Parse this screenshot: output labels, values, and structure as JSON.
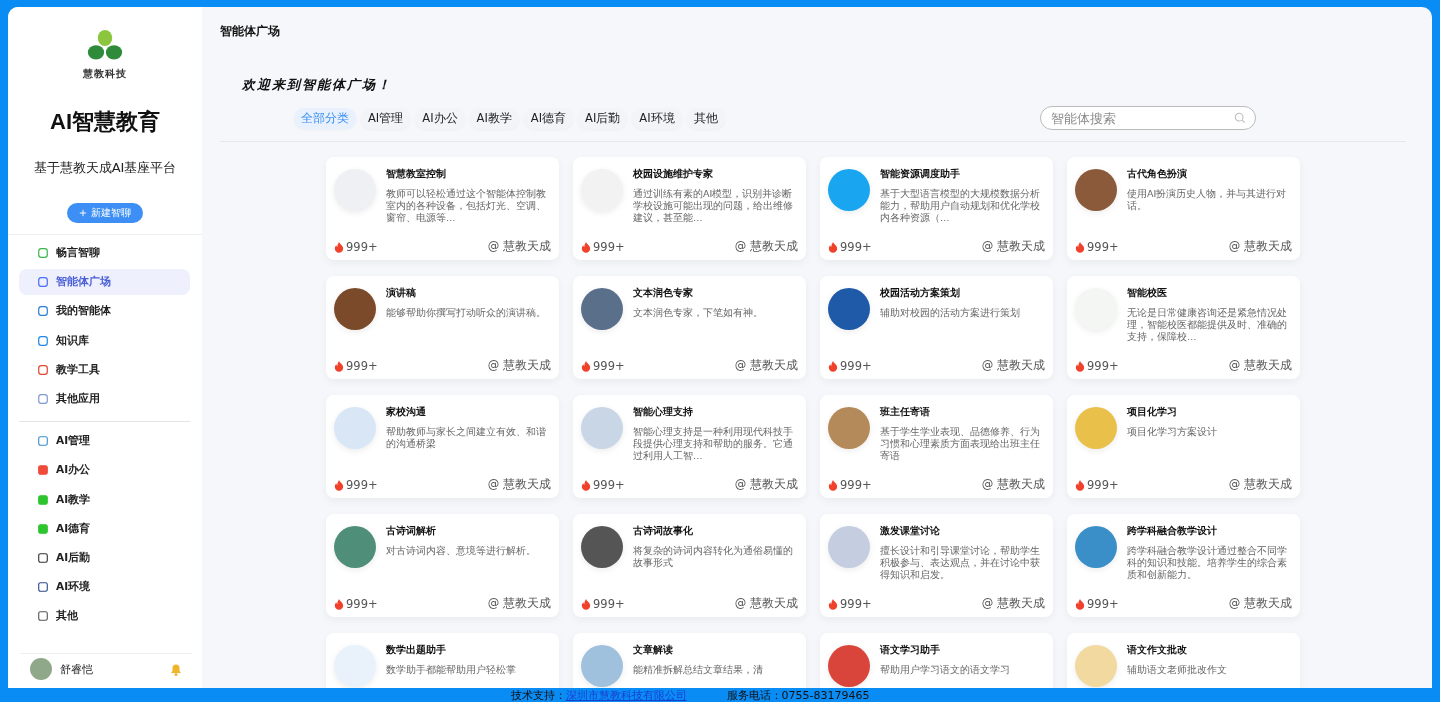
{
  "sidebar": {
    "logo_text": "慧教科技",
    "title": "AI智慧教育",
    "subtitle": "基于慧教天成AI基座平台",
    "new_button": "新建智聊",
    "items": [
      {
        "label": "畅言智聊",
        "selected": false
      },
      {
        "label": "智能体广场",
        "selected": true
      },
      {
        "label": "我的智能体",
        "selected": false
      },
      {
        "label": "知识库",
        "selected": false
      },
      {
        "label": "教学工具",
        "selected": false
      },
      {
        "label": "其他应用",
        "selected": false
      }
    ],
    "categories": [
      {
        "label": "AI管理",
        "selected": false
      },
      {
        "label": "AI办公",
        "selected": false
      },
      {
        "label": "AI教学",
        "selected": false
      },
      {
        "label": "AI德育",
        "selected": false
      },
      {
        "label": "AI后勤",
        "selected": false
      },
      {
        "label": "AI环境",
        "selected": false
      },
      {
        "label": "其他",
        "selected": false
      }
    ],
    "user": {
      "name": "舒睿恺"
    }
  },
  "header": {
    "title": "智能体广场"
  },
  "welcome": "欢迎来到智能体广场！",
  "filters": [
    {
      "label": "全部分类",
      "selected": true
    },
    {
      "label": "AI管理",
      "selected": false
    },
    {
      "label": "AI办公",
      "selected": false
    },
    {
      "label": "AI教学",
      "selected": false
    },
    {
      "label": "AI德育",
      "selected": false
    },
    {
      "label": "AI后勤",
      "selected": false
    },
    {
      "label": "AI环境",
      "selected": false
    },
    {
      "label": "其他",
      "selected": false
    }
  ],
  "search": {
    "placeholder": "智能体搜索"
  },
  "agents": [
    {
      "name": "智慧教室控制",
      "description": "教师可以轻松通过这个智能体控制教室内的各种设备，包括灯光、空调、窗帘、电源等…",
      "uses": "999+",
      "author": "@ 慧教天成"
    },
    {
      "name": "校园设施维护专家",
      "description": "通过训练有素的AI模型，识别并诊断学校设施可能出现的问题，给出维修建议，甚至能…",
      "uses": "999+",
      "author": "@ 慧教天成"
    },
    {
      "name": "智能资源调度助手",
      "description": "基于大型语言模型的大规模数据分析能力，帮助用户自动规划和优化学校内各种资源（…",
      "uses": "999+",
      "author": "@ 慧教天成"
    },
    {
      "name": "古代角色扮演",
      "description": "使用AI扮演历史人物，并与其进行对话。",
      "uses": "999+",
      "author": "@ 慧教天成"
    },
    {
      "name": "演讲稿",
      "description": "能够帮助你撰写打动听众的演讲稿。",
      "uses": "999+",
      "author": "@ 慧教天成"
    },
    {
      "name": "文本润色专家",
      "description": "文本润色专家，下笔如有神。",
      "uses": "999+",
      "author": "@ 慧教天成"
    },
    {
      "name": "校园活动方案策划",
      "description": "辅助对校园的活动方案进行策划",
      "uses": "999+",
      "author": "@ 慧教天成"
    },
    {
      "name": "智能校医",
      "description": "无论是日常健康咨询还是紧急情况处理，智能校医都能提供及时、准确的支持，保障校…",
      "uses": "999+",
      "author": "@ 慧教天成"
    },
    {
      "name": "家校沟通",
      "description": "帮助教师与家长之间建立有效、和谐的沟通桥梁",
      "uses": "999+",
      "author": "@ 慧教天成"
    },
    {
      "name": "智能心理支持",
      "description": "智能心理支持是一种利用现代科技手段提供心理支持和帮助的服务。它通过利用人工智…",
      "uses": "999+",
      "author": "@ 慧教天成"
    },
    {
      "name": "班主任寄语",
      "description": "基于学生学业表现、品德修养、行为习惯和心理素质方面表现给出班主任寄语",
      "uses": "999+",
      "author": "@ 慧教天成"
    },
    {
      "name": "项目化学习",
      "description": "项目化学习方案设计",
      "uses": "999+",
      "author": "@ 慧教天成"
    },
    {
      "name": "古诗词解析",
      "description": "对古诗词内容、意境等进行解析。",
      "uses": "999+",
      "author": "@ 慧教天成"
    },
    {
      "name": "古诗词故事化",
      "description": "将复杂的诗词内容转化为通俗易懂的故事形式",
      "uses": "999+",
      "author": "@ 慧教天成"
    },
    {
      "name": "激发课堂讨论",
      "description": "擅长设计和引导课堂讨论，帮助学生积极参与、表达观点，并在讨论中获得知识和启发。",
      "uses": "999+",
      "author": "@ 慧教天成"
    },
    {
      "name": "跨学科融合教学设计",
      "description": "跨学科融合教学设计通过整合不同学科的知识和技能。培养学生的综合素质和创新能力。",
      "uses": "999+",
      "author": "@ 慧教天成"
    },
    {
      "name": "数学出题助手",
      "description": "数学助手都能帮助用户轻松掌"
    },
    {
      "name": "文章解读",
      "description": "能精准拆解总结文章结果，清"
    },
    {
      "name": "语文学习助手",
      "description": "帮助用户学习语文的语文学习"
    },
    {
      "name": "语文作文批改",
      "description": "辅助语文老师批改作文"
    }
  ],
  "footer": {
    "support_label": "技术支持：",
    "company": "深圳市慧教科技有限公司",
    "phone": "服务电话：0755-83179465"
  }
}
